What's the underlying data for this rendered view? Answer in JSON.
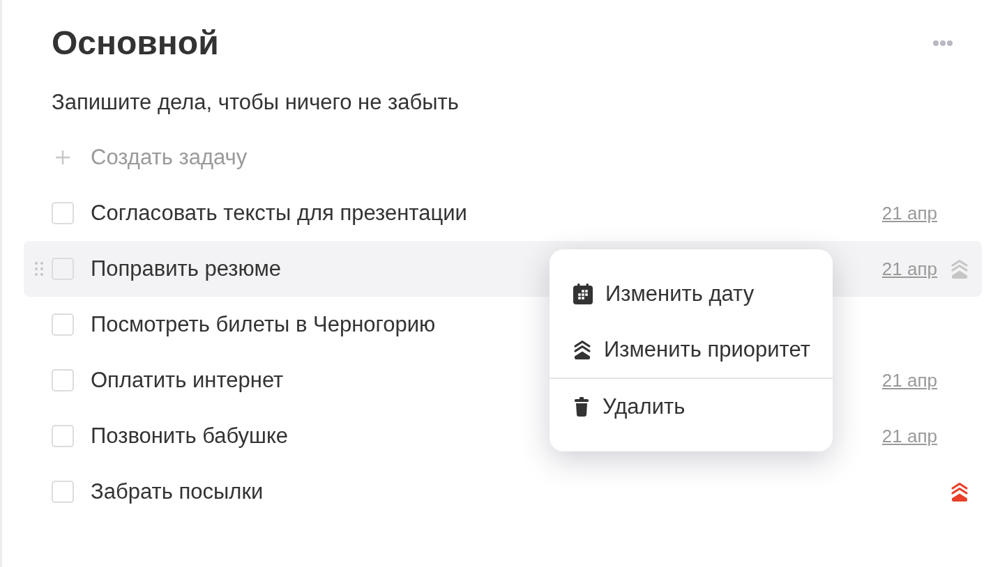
{
  "list": {
    "title": "Основной",
    "description": "Запишите дела, чтобы ничего не забыть",
    "add_task": {
      "label": "Создать задачу"
    }
  },
  "tasks": [
    {
      "title": "Согласовать тексты для презентации",
      "checked": false,
      "hovered": false,
      "high_priority": false,
      "date": "21 апр"
    },
    {
      "title": "Поправить резюме",
      "checked": false,
      "hovered": true,
      "high_priority": false,
      "date": "21 апр"
    },
    {
      "title": "Посмотреть билеты в Черногорию",
      "checked": false,
      "hovered": false,
      "high_priority": false
    },
    {
      "title": "Оплатить интернет",
      "checked": false,
      "hovered": false,
      "high_priority": false,
      "date": "21 апр"
    },
    {
      "title": "Позвонить бабушке",
      "checked": false,
      "hovered": false,
      "high_priority": false,
      "date": "21 апр"
    },
    {
      "title": "Забрать посылки",
      "checked": false,
      "hovered": false,
      "high_priority": true
    }
  ],
  "context_menu": {
    "sections": [
      {
        "items": [
          {
            "label": "Изменить дату"
          },
          {
            "label": "Изменить приоритет"
          }
        ]
      },
      {
        "items": [
          {
            "label": "Удалить"
          }
        ]
      }
    ]
  }
}
